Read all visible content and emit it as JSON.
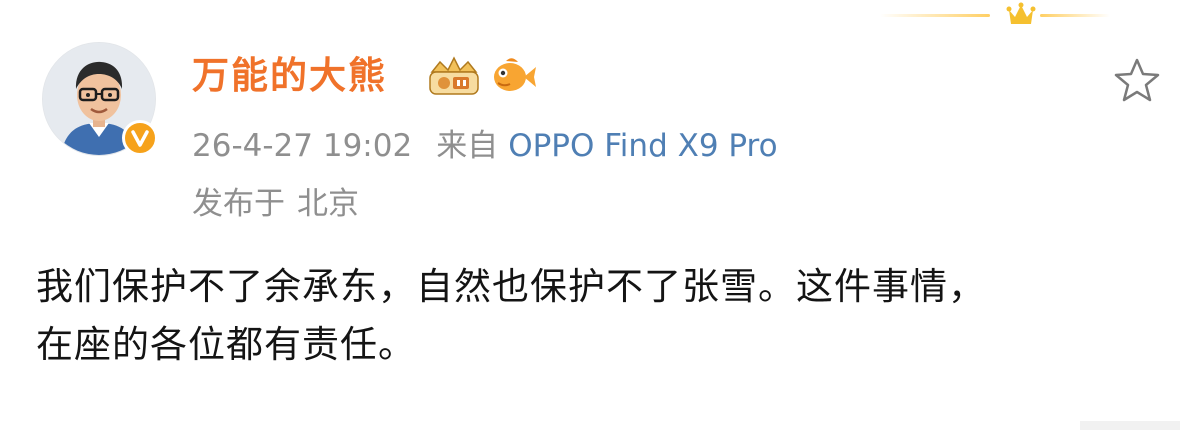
{
  "post": {
    "username": "万能的大熊",
    "timestamp": "26-4-27 19:02",
    "from_label": "来自",
    "device": "OPPO Find X9 Pro",
    "location_label": "发布于",
    "location": "北京",
    "text_line1": "我们保护不了余承东，自然也保护不了张雪。这件事情，",
    "text_line2": "在座的各位都有责任。"
  },
  "icons": {
    "crown": "crown-icon",
    "verified": "verified-v-icon",
    "level_badge": "king-level-badge-icon",
    "fan_badge": "goldfish-badge-icon",
    "favorite": "star-outline-icon"
  },
  "colors": {
    "username": "#f0722a",
    "meta": "#8f8f8f",
    "device": "#4f7fb4",
    "verified": "#f6a21b",
    "crown": "#f5c02f"
  }
}
